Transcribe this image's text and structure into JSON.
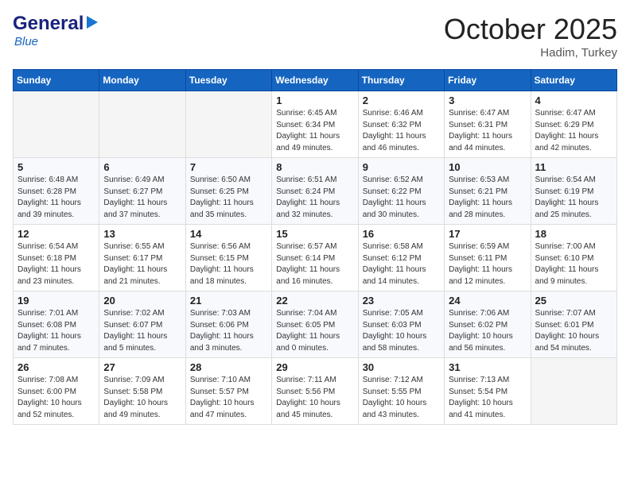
{
  "header": {
    "logo_general": "General",
    "logo_blue": "Blue",
    "month_title": "October 2025",
    "location": "Hadim, Turkey"
  },
  "days_of_week": [
    "Sunday",
    "Monday",
    "Tuesday",
    "Wednesday",
    "Thursday",
    "Friday",
    "Saturday"
  ],
  "weeks": [
    [
      {
        "day": "",
        "info": ""
      },
      {
        "day": "",
        "info": ""
      },
      {
        "day": "",
        "info": ""
      },
      {
        "day": "1",
        "info": "Sunrise: 6:45 AM\nSunset: 6:34 PM\nDaylight: 11 hours\nand 49 minutes."
      },
      {
        "day": "2",
        "info": "Sunrise: 6:46 AM\nSunset: 6:32 PM\nDaylight: 11 hours\nand 46 minutes."
      },
      {
        "day": "3",
        "info": "Sunrise: 6:47 AM\nSunset: 6:31 PM\nDaylight: 11 hours\nand 44 minutes."
      },
      {
        "day": "4",
        "info": "Sunrise: 6:47 AM\nSunset: 6:29 PM\nDaylight: 11 hours\nand 42 minutes."
      }
    ],
    [
      {
        "day": "5",
        "info": "Sunrise: 6:48 AM\nSunset: 6:28 PM\nDaylight: 11 hours\nand 39 minutes."
      },
      {
        "day": "6",
        "info": "Sunrise: 6:49 AM\nSunset: 6:27 PM\nDaylight: 11 hours\nand 37 minutes."
      },
      {
        "day": "7",
        "info": "Sunrise: 6:50 AM\nSunset: 6:25 PM\nDaylight: 11 hours\nand 35 minutes."
      },
      {
        "day": "8",
        "info": "Sunrise: 6:51 AM\nSunset: 6:24 PM\nDaylight: 11 hours\nand 32 minutes."
      },
      {
        "day": "9",
        "info": "Sunrise: 6:52 AM\nSunset: 6:22 PM\nDaylight: 11 hours\nand 30 minutes."
      },
      {
        "day": "10",
        "info": "Sunrise: 6:53 AM\nSunset: 6:21 PM\nDaylight: 11 hours\nand 28 minutes."
      },
      {
        "day": "11",
        "info": "Sunrise: 6:54 AM\nSunset: 6:19 PM\nDaylight: 11 hours\nand 25 minutes."
      }
    ],
    [
      {
        "day": "12",
        "info": "Sunrise: 6:54 AM\nSunset: 6:18 PM\nDaylight: 11 hours\nand 23 minutes."
      },
      {
        "day": "13",
        "info": "Sunrise: 6:55 AM\nSunset: 6:17 PM\nDaylight: 11 hours\nand 21 minutes."
      },
      {
        "day": "14",
        "info": "Sunrise: 6:56 AM\nSunset: 6:15 PM\nDaylight: 11 hours\nand 18 minutes."
      },
      {
        "day": "15",
        "info": "Sunrise: 6:57 AM\nSunset: 6:14 PM\nDaylight: 11 hours\nand 16 minutes."
      },
      {
        "day": "16",
        "info": "Sunrise: 6:58 AM\nSunset: 6:12 PM\nDaylight: 11 hours\nand 14 minutes."
      },
      {
        "day": "17",
        "info": "Sunrise: 6:59 AM\nSunset: 6:11 PM\nDaylight: 11 hours\nand 12 minutes."
      },
      {
        "day": "18",
        "info": "Sunrise: 7:00 AM\nSunset: 6:10 PM\nDaylight: 11 hours\nand 9 minutes."
      }
    ],
    [
      {
        "day": "19",
        "info": "Sunrise: 7:01 AM\nSunset: 6:08 PM\nDaylight: 11 hours\nand 7 minutes."
      },
      {
        "day": "20",
        "info": "Sunrise: 7:02 AM\nSunset: 6:07 PM\nDaylight: 11 hours\nand 5 minutes."
      },
      {
        "day": "21",
        "info": "Sunrise: 7:03 AM\nSunset: 6:06 PM\nDaylight: 11 hours\nand 3 minutes."
      },
      {
        "day": "22",
        "info": "Sunrise: 7:04 AM\nSunset: 6:05 PM\nDaylight: 11 hours\nand 0 minutes."
      },
      {
        "day": "23",
        "info": "Sunrise: 7:05 AM\nSunset: 6:03 PM\nDaylight: 10 hours\nand 58 minutes."
      },
      {
        "day": "24",
        "info": "Sunrise: 7:06 AM\nSunset: 6:02 PM\nDaylight: 10 hours\nand 56 minutes."
      },
      {
        "day": "25",
        "info": "Sunrise: 7:07 AM\nSunset: 6:01 PM\nDaylight: 10 hours\nand 54 minutes."
      }
    ],
    [
      {
        "day": "26",
        "info": "Sunrise: 7:08 AM\nSunset: 6:00 PM\nDaylight: 10 hours\nand 52 minutes."
      },
      {
        "day": "27",
        "info": "Sunrise: 7:09 AM\nSunset: 5:58 PM\nDaylight: 10 hours\nand 49 minutes."
      },
      {
        "day": "28",
        "info": "Sunrise: 7:10 AM\nSunset: 5:57 PM\nDaylight: 10 hours\nand 47 minutes."
      },
      {
        "day": "29",
        "info": "Sunrise: 7:11 AM\nSunset: 5:56 PM\nDaylight: 10 hours\nand 45 minutes."
      },
      {
        "day": "30",
        "info": "Sunrise: 7:12 AM\nSunset: 5:55 PM\nDaylight: 10 hours\nand 43 minutes."
      },
      {
        "day": "31",
        "info": "Sunrise: 7:13 AM\nSunset: 5:54 PM\nDaylight: 10 hours\nand 41 minutes."
      },
      {
        "day": "",
        "info": ""
      }
    ]
  ]
}
